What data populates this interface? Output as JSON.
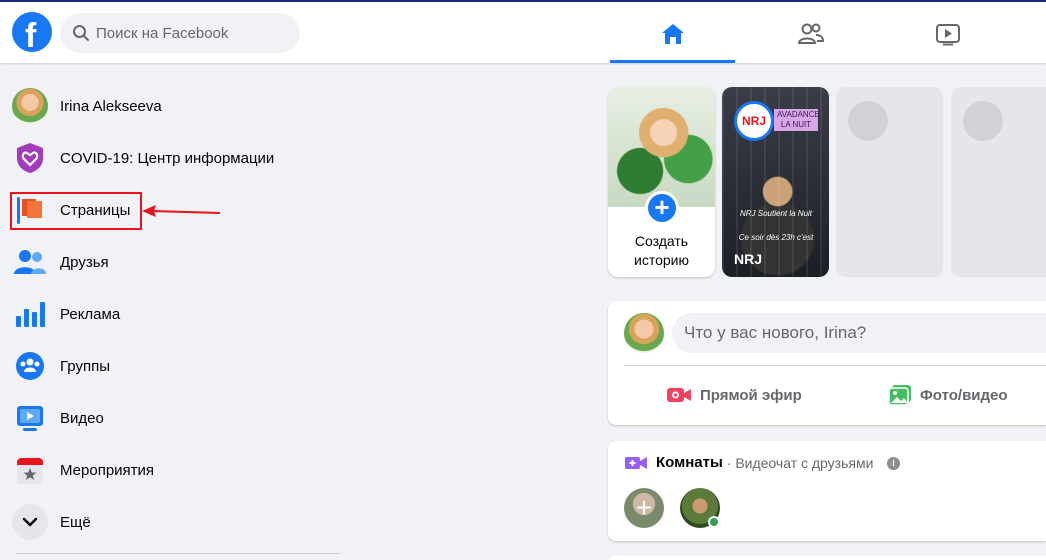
{
  "header": {
    "logo_letter": "f",
    "search_placeholder": "Поиск на Facebook"
  },
  "sidebar": {
    "items": [
      {
        "label": "Irina Alekseeva",
        "icon": "profile-avatar"
      },
      {
        "label": "COVID-19: Центр информации",
        "icon": "covid-heart-shield-icon"
      },
      {
        "label": "Страницы",
        "icon": "pages-flag-icon"
      },
      {
        "label": "Друзья",
        "icon": "friends-icon"
      },
      {
        "label": "Реклама",
        "icon": "ads-chart-icon"
      },
      {
        "label": "Группы",
        "icon": "groups-icon"
      },
      {
        "label": "Видео",
        "icon": "video-icon"
      },
      {
        "label": "Мероприятия",
        "icon": "events-calendar-icon"
      },
      {
        "label": "Ещё",
        "icon": "chevron-down-icon"
      }
    ]
  },
  "stories": {
    "create_label_line1": "Создать",
    "create_label_line2": "историю",
    "nrj": {
      "logo_text": "NRJ",
      "tag_line1": "AVADANCE",
      "tag_line2": "LA NUIT",
      "caption1": "NRJ Soutient la Nuit",
      "caption2": "Ce soir dès 23h c'est",
      "name": "NRJ"
    }
  },
  "composer": {
    "placeholder": "Что у вас нового, Irina?",
    "live_label": "Прямой эфир",
    "photo_label": "Фото/видео"
  },
  "rooms": {
    "title": "Комнаты",
    "subtitle": "· Видеочат с друзьями",
    "info_glyph": "i",
    "plus_glyph": "+"
  },
  "colors": {
    "brand": "#1877f2",
    "highlight": "#e8131b",
    "live": "#f3425f",
    "photo": "#45bd62",
    "rooms": "#9360f7"
  }
}
